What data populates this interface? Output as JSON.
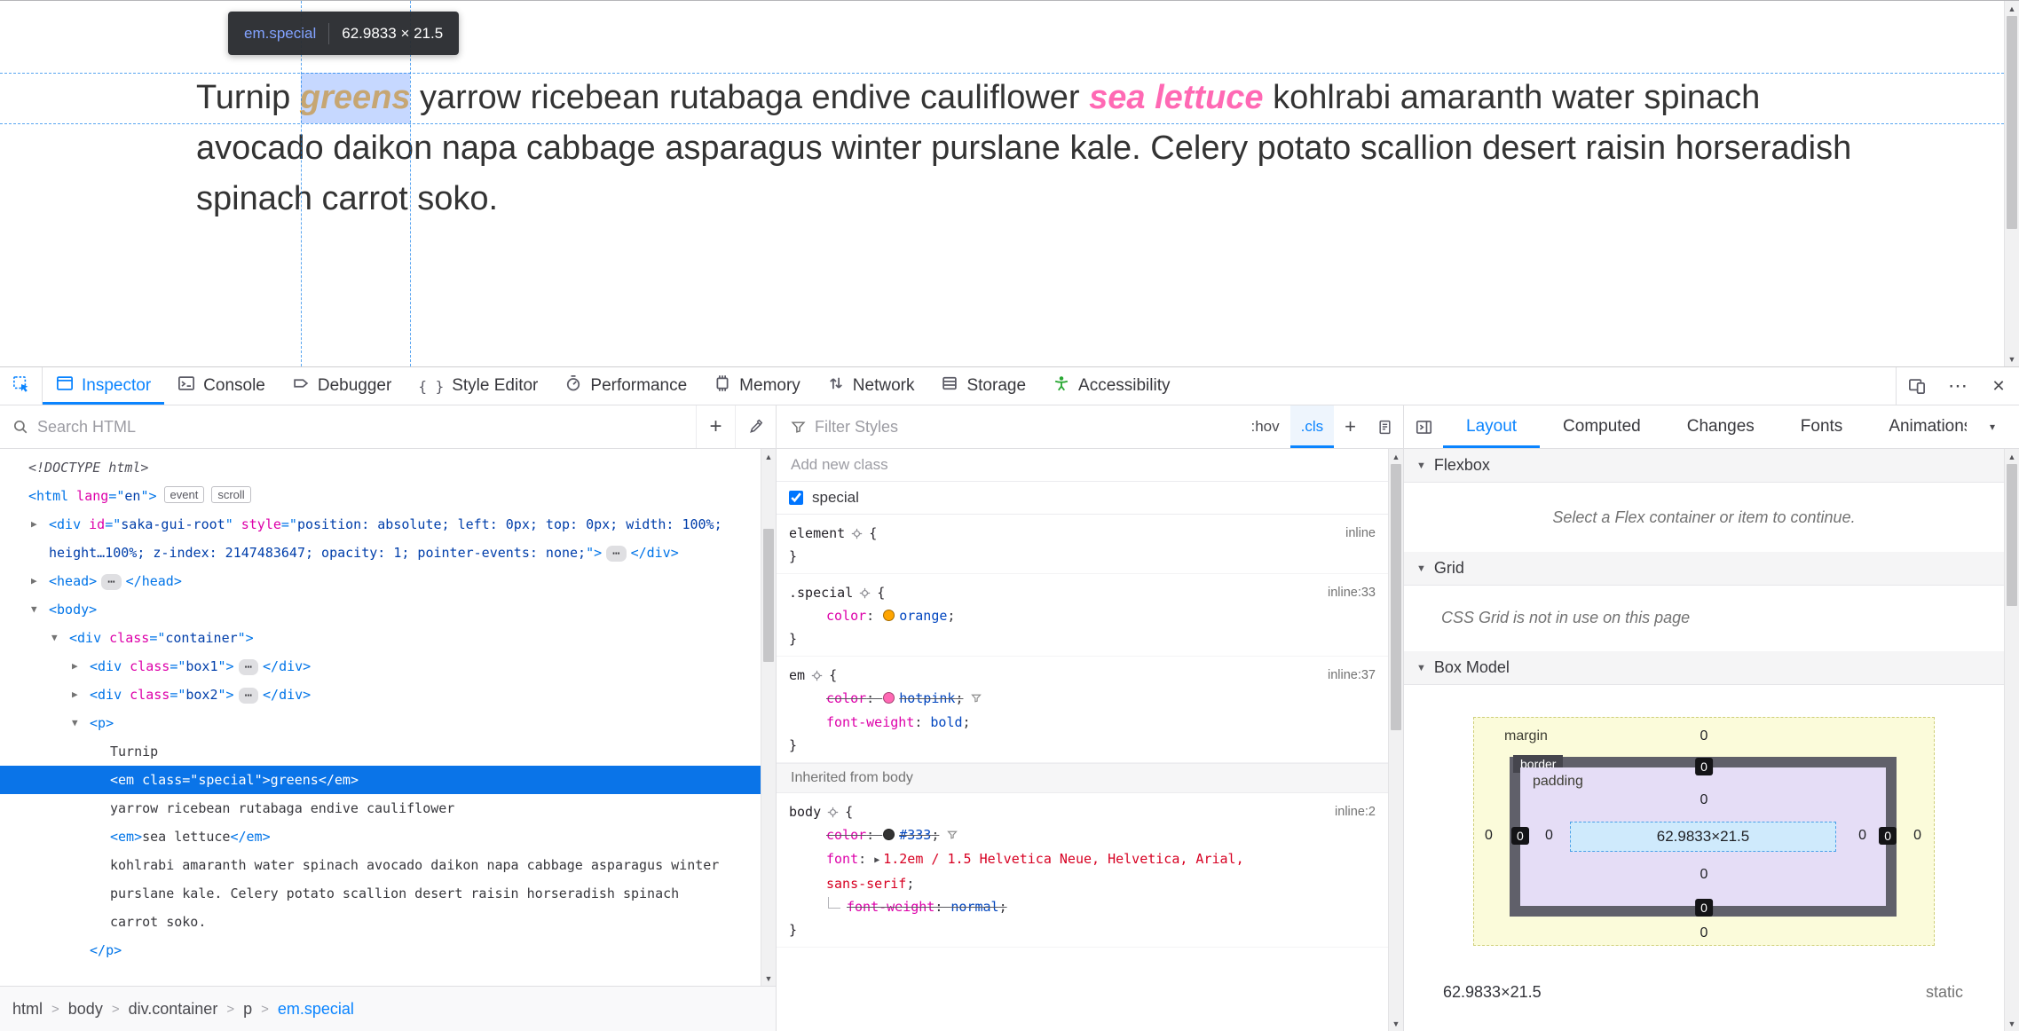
{
  "page": {
    "tooltip": {
      "selector": "em.special",
      "size": "62.9833 × 21.5"
    },
    "text": {
      "t1": "Turnip ",
      "em_special": "greens",
      "t2": " yarrow ricebean rutabaga endive cauliflower ",
      "em_plain": "sea lettuce",
      "t3": " kohlrabi amaranth water spinach avocado daikon napa cabbage asparagus winter purslane kale. Celery potato scallion desert raisin horseradish spinach carrot soko."
    }
  },
  "toolbar": {
    "tabs": [
      {
        "label": "Inspector",
        "active": true
      },
      {
        "label": "Console"
      },
      {
        "label": "Debugger"
      },
      {
        "label": "Style Editor"
      },
      {
        "label": "Performance"
      },
      {
        "label": "Memory"
      },
      {
        "label": "Network"
      },
      {
        "label": "Storage"
      },
      {
        "label": "Accessibility"
      }
    ]
  },
  "markup": {
    "search_placeholder": "Search HTML",
    "rows": [
      {
        "level": 0,
        "twisty": null,
        "selected": false,
        "parts": [
          [
            "doctype",
            "<!DOCTYPE html>"
          ]
        ]
      },
      {
        "level": 0,
        "twisty": null,
        "selected": false,
        "parts": [
          [
            "punc",
            "<"
          ],
          [
            "tag",
            "html"
          ],
          [
            "attr",
            " lang"
          ],
          [
            "punc",
            "=\""
          ],
          [
            "val",
            "en"
          ],
          [
            "punc",
            "\">"
          ],
          [
            "badge",
            "event"
          ],
          [
            "badge",
            "scroll"
          ]
        ]
      },
      {
        "level": 1,
        "twisty": "closed",
        "selected": false,
        "parts": [
          [
            "punc",
            "<"
          ],
          [
            "tag",
            "div"
          ],
          [
            "attr",
            " id"
          ],
          [
            "punc",
            "=\""
          ],
          [
            "val",
            "saka-gui-root"
          ],
          [
            "punc",
            "\""
          ],
          [
            "attr",
            " style"
          ],
          [
            "punc",
            "=\""
          ],
          [
            "val",
            "position: absolute; left: 0px; top: 0px; width: 100%; height…100%; z-index: 2147483647; opacity: 1; pointer-events: none;"
          ],
          [
            "punc",
            "\">"
          ],
          [
            "pill",
            "⋯"
          ],
          [
            "punc",
            "</"
          ],
          [
            "tag",
            "div"
          ],
          [
            "punc",
            ">"
          ]
        ]
      },
      {
        "level": 1,
        "twisty": "closed",
        "selected": false,
        "parts": [
          [
            "punc",
            "<"
          ],
          [
            "tag",
            "head"
          ],
          [
            "punc",
            ">"
          ],
          [
            "pill",
            "⋯"
          ],
          [
            "punc",
            "</"
          ],
          [
            "tag",
            "head"
          ],
          [
            "punc",
            ">"
          ]
        ]
      },
      {
        "level": 1,
        "twisty": "open",
        "selected": false,
        "parts": [
          [
            "punc",
            "<"
          ],
          [
            "tag",
            "body"
          ],
          [
            "punc",
            ">"
          ]
        ]
      },
      {
        "level": 2,
        "twisty": "open",
        "selected": false,
        "parts": [
          [
            "punc",
            "<"
          ],
          [
            "tag",
            "div"
          ],
          [
            "attr",
            " class"
          ],
          [
            "punc",
            "=\""
          ],
          [
            "val",
            "container"
          ],
          [
            "punc",
            "\">"
          ]
        ]
      },
      {
        "level": 3,
        "twisty": "closed",
        "selected": false,
        "parts": [
          [
            "punc",
            "<"
          ],
          [
            "tag",
            "div"
          ],
          [
            "attr",
            " class"
          ],
          [
            "punc",
            "=\""
          ],
          [
            "val",
            "box1"
          ],
          [
            "punc",
            "\">"
          ],
          [
            "pill",
            "⋯"
          ],
          [
            "punc",
            "</"
          ],
          [
            "tag",
            "div"
          ],
          [
            "punc",
            ">"
          ]
        ]
      },
      {
        "level": 3,
        "twisty": "closed",
        "selected": false,
        "parts": [
          [
            "punc",
            "<"
          ],
          [
            "tag",
            "div"
          ],
          [
            "attr",
            " class"
          ],
          [
            "punc",
            "=\""
          ],
          [
            "val",
            "box2"
          ],
          [
            "punc",
            "\">"
          ],
          [
            "pill",
            "⋯"
          ],
          [
            "punc",
            "</"
          ],
          [
            "tag",
            "div"
          ],
          [
            "punc",
            ">"
          ]
        ]
      },
      {
        "level": 3,
        "twisty": "open",
        "selected": false,
        "parts": [
          [
            "punc",
            "<"
          ],
          [
            "tag",
            "p"
          ],
          [
            "punc",
            ">"
          ]
        ]
      },
      {
        "level": 4,
        "twisty": null,
        "selected": false,
        "parts": [
          [
            "text",
            "Turnip"
          ]
        ]
      },
      {
        "level": 4,
        "twisty": null,
        "selected": true,
        "parts": [
          [
            "punc",
            "<"
          ],
          [
            "tag",
            "em"
          ],
          [
            "attr",
            " class"
          ],
          [
            "punc",
            "=\""
          ],
          [
            "val",
            "special"
          ],
          [
            "punc",
            "\">"
          ],
          [
            "text",
            "greens"
          ],
          [
            "punc",
            "</"
          ],
          [
            "tag",
            "em"
          ],
          [
            "punc",
            ">"
          ]
        ]
      },
      {
        "level": 4,
        "twisty": null,
        "selected": false,
        "parts": [
          [
            "text",
            "yarrow ricebean rutabaga endive cauliflower"
          ]
        ]
      },
      {
        "level": 4,
        "twisty": null,
        "selected": false,
        "parts": [
          [
            "punc",
            "<"
          ],
          [
            "tag",
            "em"
          ],
          [
            "punc",
            ">"
          ],
          [
            "text",
            "sea lettuce"
          ],
          [
            "punc",
            "</"
          ],
          [
            "tag",
            "em"
          ],
          [
            "punc",
            ">"
          ]
        ]
      },
      {
        "level": 4,
        "twisty": null,
        "selected": false,
        "parts": [
          [
            "text",
            "kohlrabi amaranth water spinach avocado daikon napa cabbage asparagus winter purslane kale. Celery potato scallion desert raisin horseradish spinach carrot soko."
          ]
        ]
      },
      {
        "level": 3,
        "twisty": null,
        "selected": false,
        "parts": [
          [
            "punc",
            "</"
          ],
          [
            "tag",
            "p"
          ],
          [
            "punc",
            ">"
          ]
        ]
      }
    ],
    "breadcrumbs": [
      {
        "label": "html"
      },
      {
        "label": "body"
      },
      {
        "label": "div.container"
      },
      {
        "label": "p"
      },
      {
        "label": "em.special",
        "selected": true
      }
    ]
  },
  "rules": {
    "filter_placeholder": "Filter Styles",
    "hov": ":hov",
    "cls": ".cls",
    "add_label": "+",
    "add_class_placeholder": "Add new class",
    "class_toggles": [
      {
        "name": "special",
        "checked": true
      }
    ],
    "sections": [
      {
        "header": null,
        "rules": [
          {
            "selector": "element",
            "location": "inline",
            "decls": []
          },
          {
            "selector": ".special",
            "location": "inline:33",
            "decls": [
              {
                "prop": "color",
                "value": "orange",
                "swatch": "#ffa500"
              }
            ]
          },
          {
            "selector": "em",
            "location": "inline:37",
            "decls": [
              {
                "prop": "color",
                "value": "hotpink",
                "swatch": "#ff69b4",
                "struck": true,
                "funnel": true
              },
              {
                "prop": "font-weight",
                "value": "bold"
              }
            ]
          }
        ]
      },
      {
        "header": "Inherited from body",
        "rules": [
          {
            "selector": "body",
            "location": "inline:2",
            "decls": [
              {
                "prop": "color",
                "value": "#333",
                "swatch": "#333333",
                "struck": true,
                "funnel": true
              },
              {
                "prop": "font",
                "value": "1.2em / 1.5 Helvetica Neue, Helvetica, Arial, sans-serif",
                "expand": true,
                "red": true
              },
              {
                "prop": "font-weight",
                "value": "normal",
                "struck": true,
                "sub": true
              }
            ]
          }
        ]
      }
    ]
  },
  "layout": {
    "tabs": [
      {
        "label": "Layout",
        "active": true
      },
      {
        "label": "Computed"
      },
      {
        "label": "Changes"
      },
      {
        "label": "Fonts"
      },
      {
        "label": "Animations"
      }
    ],
    "flexbox": {
      "title": "Flexbox",
      "message": "Select a Flex container or item to continue."
    },
    "grid": {
      "title": "Grid",
      "message": "CSS Grid is not in use on this page"
    },
    "boxmodel": {
      "title": "Box Model",
      "labels": {
        "margin": "margin",
        "border": "border",
        "padding": "padding"
      },
      "content": "62.9833×21.5",
      "margin": {
        "top": "0",
        "right": "0",
        "bottom": "0",
        "left": "0"
      },
      "border": {
        "top": "0",
        "right": "0",
        "bottom": "0",
        "left": "0"
      },
      "padding": {
        "top": "0",
        "right": "0",
        "bottom": "0",
        "left": "0"
      },
      "size": "62.9833×21.5",
      "position": "static"
    }
  }
}
